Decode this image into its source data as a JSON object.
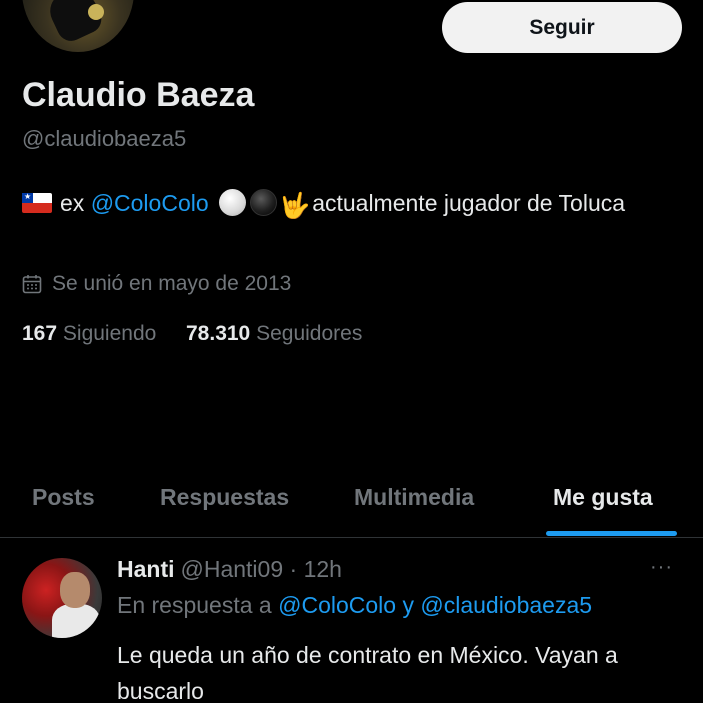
{
  "profile": {
    "name": "Claudio Baeza",
    "handle": "@claudiobaeza5",
    "follow_label": "Seguir",
    "bio": {
      "flag": "Chile flag",
      "prefix": "ex",
      "mention": "@ColoColo",
      "emojis": [
        "white-circle",
        "black-circle",
        "rock-on-hand"
      ],
      "text_after": "actualmente jugador de Toluca"
    },
    "joined": "Se unió en mayo de 2013",
    "following_count": "167",
    "following_label": "Siguiendo",
    "followers_count": "78.310",
    "followers_label": "Seguidores"
  },
  "tabs": {
    "posts": "Posts",
    "replies": "Respuestas",
    "media": "Multimedia",
    "likes": "Me gusta",
    "active": "likes"
  },
  "tweet": {
    "author_name": "Hanti",
    "author_handle": "@Hanti09",
    "separator": "·",
    "time": "12h",
    "reply_prefix": "En respuesta a",
    "reply_mention_1": "@ColoColo",
    "reply_joiner": "y",
    "reply_mention_2": "@claudiobaeza5",
    "text": "Le queda un año de contrato en México. Vayan a buscarlo",
    "more": "···"
  },
  "colors": {
    "background": "#000000",
    "text": "#e7e9ea",
    "muted": "#71767b",
    "accent": "#1d9bf0",
    "button_bg": "#f2f2f2"
  }
}
